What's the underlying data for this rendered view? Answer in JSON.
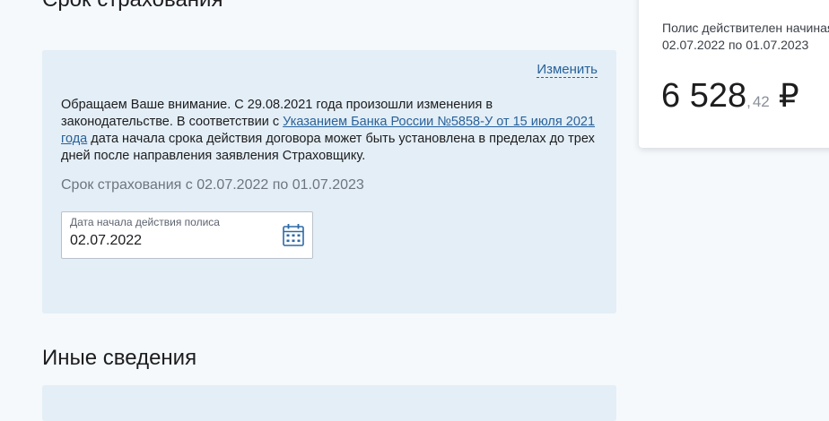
{
  "top_heading": "Срок страхования",
  "info_panel": {
    "change_link": "Изменить",
    "notice_part1": "Обращаем Ваше внимание. С 29.08.2021 года произошли изменения в законодательстве. В соответствии с ",
    "notice_link": "Указанием Банка России №5858-У от 15 июля 2021 года",
    "notice_part2": " дата начала срока действия договора может быть установлена в пределах до трех дней после направления заявления Страховщику.",
    "term_text": "Срок страхования с 02.07.2022 по 01.07.2023",
    "date_field": {
      "label": "Дата начала действия полиса",
      "value": "02.07.2022",
      "icon": "calendar-icon"
    }
  },
  "section_title": "Иные сведения",
  "price_card": {
    "validity_line1": "Полис действителен начиная с",
    "validity_line2": "02.07.2022 по 01.07.2023",
    "rubles": "6 528",
    "separator": ",",
    "kopecks": "42",
    "currency": "₽"
  },
  "colors": {
    "page_bg": "#f5f9fc",
    "panel_bg": "#e3eef6",
    "link": "#29629a",
    "icon": "#2c6aa6"
  }
}
